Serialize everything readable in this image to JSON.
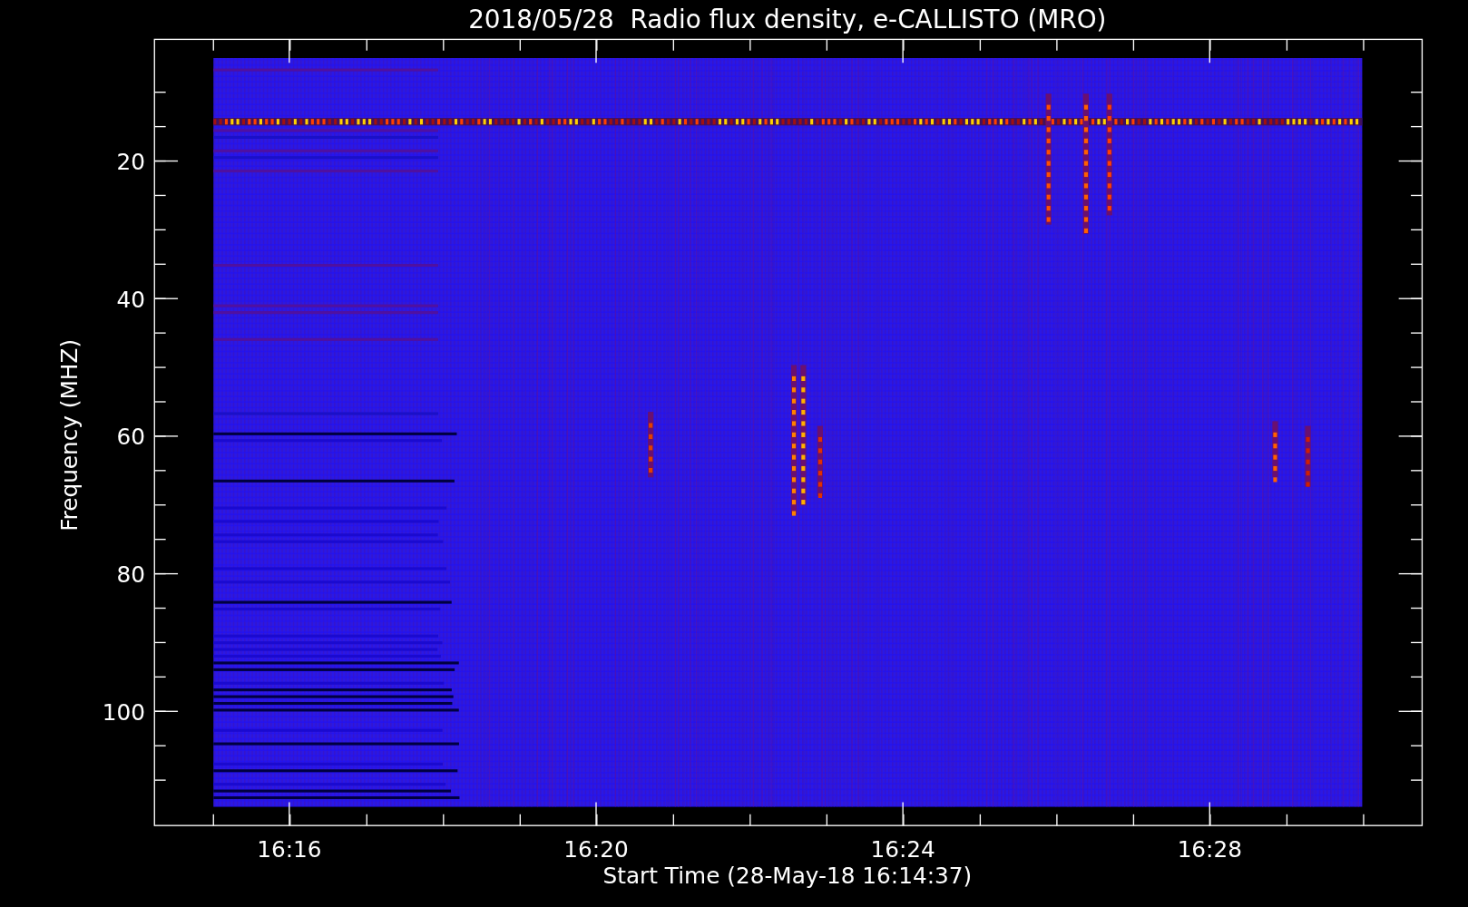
{
  "plot": {
    "title": "2018/05/28  Radio flux density, e-CALLISTO (MRO)",
    "ylabel": "Frequency (MHZ)",
    "xlabel": "Start Time (28-May-18 16:14:37)",
    "y_tick_labels": [
      "20",
      "40",
      "60",
      "80",
      "100"
    ],
    "x_tick_labels": [
      "16:16",
      "16:20",
      "16:24",
      "16:28"
    ]
  }
}
